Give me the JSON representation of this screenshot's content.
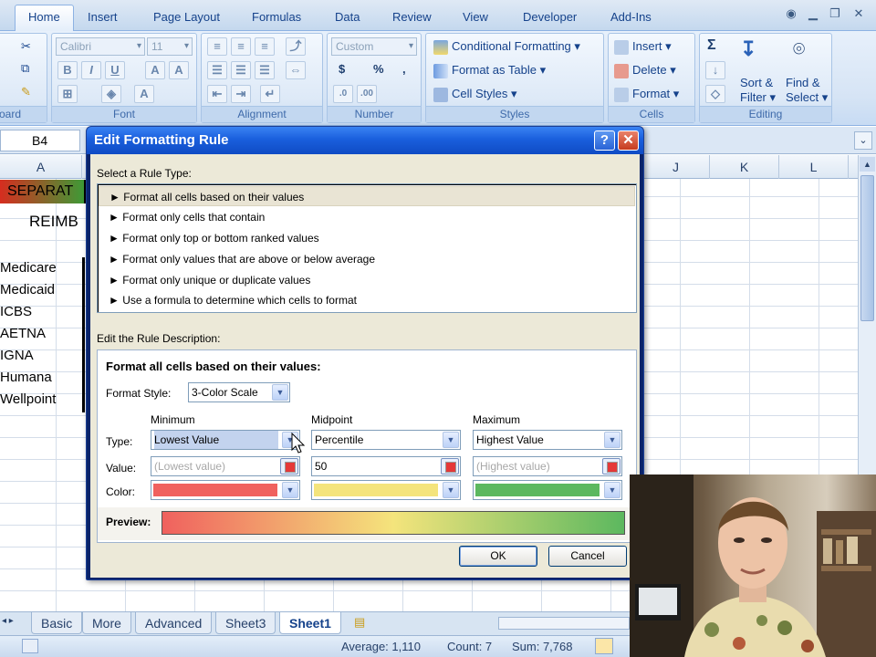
{
  "ribbon": {
    "tabs": [
      "Home",
      "Insert",
      "Page Layout",
      "Formulas",
      "Data",
      "Review",
      "View",
      "Developer",
      "Add-Ins"
    ],
    "clipboard": {
      "label": "oard"
    },
    "font": {
      "name": "Calibri",
      "size": "11",
      "label": "Font",
      "bold": "B",
      "italic": "I",
      "underline": "U"
    },
    "alignment": {
      "label": "Alignment"
    },
    "number": {
      "format": "Custom",
      "currency": "$",
      "percent": "%",
      "comma": ",",
      "label": "Number"
    },
    "styles": {
      "conditional": "Conditional Formatting",
      "table": "Format as Table",
      "cell_styles": "Cell Styles",
      "label": "Styles"
    },
    "cells": {
      "insert": "Insert",
      "delete": "Delete",
      "format": "Format",
      "label": "Cells"
    },
    "editing": {
      "sum": "Σ",
      "sort": "Sort &",
      "filter": "Filter",
      "find": "Find &",
      "select": "Select",
      "label": "Editing"
    }
  },
  "formula_bar": {
    "cell_ref": "B4"
  },
  "grid": {
    "columns_left": [
      "A"
    ],
    "columns_right": [
      "J",
      "K",
      "L"
    ],
    "cells": [
      "SEPARAT",
      "REIMB",
      "Medicare",
      "Medicaid",
      "ICBS",
      "AETNA",
      "IGNA",
      "Humana",
      "Wellpoint"
    ]
  },
  "sheets": {
    "tabs": [
      "Basic",
      "More",
      "Advanced",
      "Sheet3",
      "Sheet1"
    ],
    "active": "Sheet1"
  },
  "status": {
    "average": "Average: 1,110",
    "count": "Count: 7",
    "sum": "Sum: 7,768"
  },
  "dialog": {
    "title": "Edit Formatting Rule",
    "help": "?",
    "close": "✕",
    "select_rule_label": "Select a Rule Type:",
    "rules": [
      "► Format all cells based on their values",
      "► Format only cells that contain",
      "► Format only top or bottom ranked values",
      "► Format only values that are above or below average",
      "► Format only unique or duplicate values",
      "► Use a formula to determine which cells to format"
    ],
    "edit_rule_label": "Edit the Rule Description:",
    "desc_heading": "Format all cells based on their values:",
    "format_style_label": "Format Style:",
    "format_style_value": "3-Color Scale",
    "headers": {
      "min": "Minimum",
      "mid": "Midpoint",
      "max": "Maximum"
    },
    "row_labels": {
      "type": "Type:",
      "value": "Value:",
      "color": "Color:"
    },
    "min": {
      "type": "Lowest Value",
      "value": "(Lowest value)",
      "color": "#f0615e"
    },
    "mid": {
      "type": "Percentile",
      "value": "50",
      "color": "#f4e47c"
    },
    "max": {
      "type": "Highest Value",
      "value": "(Highest value)",
      "color": "#5cb85f"
    },
    "preview_label": "Preview:",
    "ok": "OK",
    "cancel": "Cancel"
  }
}
